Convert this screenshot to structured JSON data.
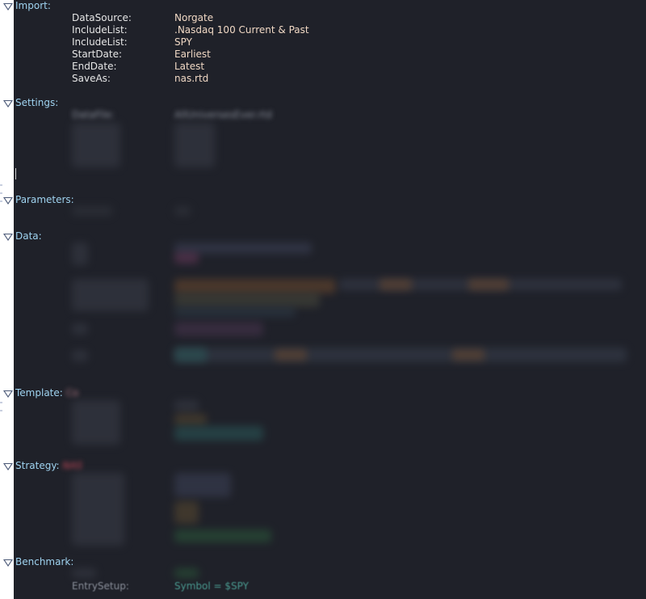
{
  "sections": {
    "import": "Import:",
    "settings": "Settings:",
    "parameters": "Parameters:",
    "data": "Data:",
    "template": "Template:",
    "template_extra": "Co",
    "strategy": "Strategy:",
    "strategy_extra": "NAS",
    "benchmark": "Benchmark:"
  },
  "import": [
    {
      "key": "DataSource:",
      "value": "Norgate"
    },
    {
      "key": "IncludeList:",
      "value": ".Nasdaq 100 Current & Past"
    },
    {
      "key": "IncludeList:",
      "value": "SPY"
    },
    {
      "key": "StartDate:",
      "value": "Earliest"
    },
    {
      "key": "EndDate:",
      "value": "Latest"
    },
    {
      "key": "SaveAs:",
      "value": "nas.rtd"
    }
  ],
  "settings": {
    "datafile_key": "DataFile:",
    "datafile_value": "AllUniversesEver.rtd"
  },
  "benchmark": {
    "entry_key": "EntrySetup:",
    "entry_value": "Symbol = $SPY"
  },
  "colors": {
    "background": "#1f2129",
    "section": "#9fd3f0",
    "key": "#e6e6e6",
    "value": "#f0d8c4",
    "fold_icon": "#4a5876"
  }
}
